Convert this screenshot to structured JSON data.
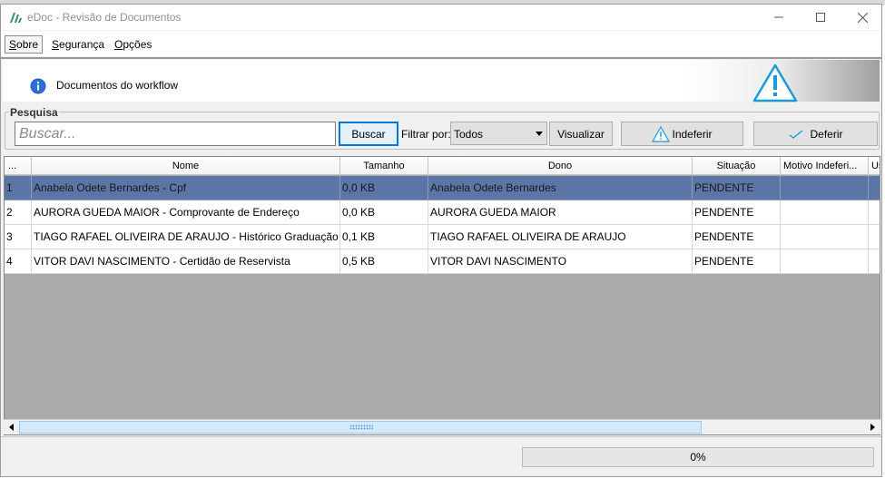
{
  "window": {
    "title": "eDoc - Revisão de Documentos",
    "controls": [
      "minimize-icon",
      "maximize-icon",
      "close-icon"
    ]
  },
  "menu": {
    "items": [
      {
        "label": "Sobre",
        "active": true
      },
      {
        "label": "Segurança",
        "active": false
      },
      {
        "label": "Opções",
        "active": false
      }
    ]
  },
  "banner": {
    "text": "Documentos do workflow",
    "icon": "info-icon",
    "right_icon": "warning-icon"
  },
  "search": {
    "group_title": "Pesquisa",
    "placeholder": "Buscar...",
    "value": "",
    "search_button": "Buscar",
    "filter_label": "Filtrar por:",
    "filter_value": "Todos",
    "view_button": "Visualizar",
    "reject_button": "Indeferir",
    "approve_button": "Deferir"
  },
  "grid": {
    "columns": [
      "...",
      "Nome",
      "Tamanho",
      "Dono",
      "Situação",
      "Motivo Indeferi...",
      "Us"
    ],
    "rows": [
      {
        "n": "1",
        "nome": "Anabela Odete Bernardes - Cpf",
        "tamanho": "0,0 KB",
        "dono": "Anabela Odete Bernardes",
        "situacao": "PENDENTE",
        "motivo": "",
        "us": "",
        "selected": true
      },
      {
        "n": "2",
        "nome": "AURORA GUEDA MAIOR - Comprovante de Endereço",
        "tamanho": "0,0 KB",
        "dono": "AURORA GUEDA MAIOR",
        "situacao": "PENDENTE",
        "motivo": "",
        "us": "",
        "selected": false
      },
      {
        "n": "3",
        "nome": "TIAGO RAFAEL OLIVEIRA DE ARAUJO - Histórico Graduação",
        "tamanho": "0,1 KB",
        "dono": "TIAGO RAFAEL OLIVEIRA DE ARAUJO",
        "situacao": "PENDENTE",
        "motivo": "",
        "us": "",
        "selected": false
      },
      {
        "n": "4",
        "nome": "VITOR DAVI NASCIMENTO - Certidão de Reservista",
        "tamanho": "0,5 KB",
        "dono": "VITOR DAVI NASCIMENTO",
        "situacao": "PENDENTE",
        "motivo": "",
        "us": "",
        "selected": false
      }
    ]
  },
  "progress": {
    "label": "0%",
    "value": 0
  },
  "colors": {
    "selected_row": "#5b75a6",
    "accent": "#0078d7",
    "info_blue": "#1e5bb8",
    "warning_cyan": "#1a9ad6"
  }
}
